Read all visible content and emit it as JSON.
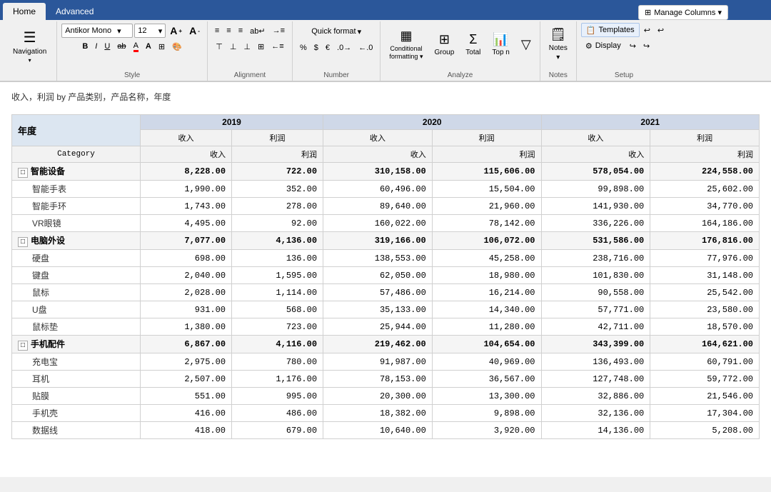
{
  "tabs": [
    {
      "label": "Home",
      "active": true
    },
    {
      "label": "Advanced",
      "active": false
    }
  ],
  "manage_columns": "Manage Columns ▾",
  "ribbon": {
    "groups": {
      "navigation": {
        "label": "Navigation",
        "icon": "☰",
        "arrow": "▾"
      },
      "style": {
        "label": "Style",
        "font": "Antikor Mono",
        "size": "12",
        "size_arrow": "▾"
      },
      "alignment": {
        "label": "Alignment"
      },
      "number": {
        "label": "Number",
        "quick_format": "Quick format",
        "quick_format_arrow": "▾"
      },
      "analyze": {
        "label": "Analyze",
        "conditional": "Conditional",
        "formatting": "formatting",
        "formatting_arrow": "▾",
        "group": "Group",
        "total": "Total",
        "top_n": "Top n"
      },
      "notes": {
        "label": "Notes",
        "notes": "Notes",
        "notes_arrow": "▾"
      },
      "setup": {
        "label": "Setup",
        "templates": "Templates",
        "display": "Display"
      }
    }
  },
  "breadcrumb": "收入，利润 by 产品类别，产品名称，年度",
  "table": {
    "year_col": "年度",
    "years": [
      "2019",
      "2020",
      "2021"
    ],
    "subcols": [
      "收入",
      "利润"
    ],
    "category_label": "Category",
    "rows": [
      {
        "type": "group",
        "label": "智能设备",
        "expand": "□",
        "values": [
          "8,228.00",
          "722.00",
          "310,158.00",
          "115,606.00",
          "578,054.00",
          "224,558.00"
        ],
        "children": [
          {
            "label": "智能手表",
            "values": [
              "1,990.00",
              "352.00",
              "60,496.00",
              "15,504.00",
              "99,898.00",
              "25,602.00"
            ]
          },
          {
            "label": "智能手环",
            "values": [
              "1,743.00",
              "278.00",
              "89,640.00",
              "21,960.00",
              "141,930.00",
              "34,770.00"
            ]
          },
          {
            "label": "VR眼镜",
            "values": [
              "4,495.00",
              "92.00",
              "160,022.00",
              "78,142.00",
              "336,226.00",
              "164,186.00"
            ]
          }
        ]
      },
      {
        "type": "group",
        "label": "电脑外设",
        "expand": "□",
        "values": [
          "7,077.00",
          "4,136.00",
          "319,166.00",
          "106,072.00",
          "531,586.00",
          "176,816.00"
        ],
        "children": [
          {
            "label": "硬盘",
            "values": [
              "698.00",
              "136.00",
              "138,553.00",
              "45,258.00",
              "238,716.00",
              "77,976.00"
            ]
          },
          {
            "label": "键盘",
            "values": [
              "2,040.00",
              "1,595.00",
              "62,050.00",
              "18,980.00",
              "101,830.00",
              "31,148.00"
            ]
          },
          {
            "label": "鼠标",
            "values": [
              "2,028.00",
              "1,114.00",
              "57,486.00",
              "16,214.00",
              "90,558.00",
              "25,542.00"
            ]
          },
          {
            "label": "U盘",
            "values": [
              "931.00",
              "568.00",
              "35,133.00",
              "14,340.00",
              "57,771.00",
              "23,580.00"
            ]
          },
          {
            "label": "鼠标垫",
            "values": [
              "1,380.00",
              "723.00",
              "25,944.00",
              "11,280.00",
              "42,711.00",
              "18,570.00"
            ]
          }
        ]
      },
      {
        "type": "group",
        "label": "手机配件",
        "expand": "□",
        "values": [
          "6,867.00",
          "4,116.00",
          "219,462.00",
          "104,654.00",
          "343,399.00",
          "164,621.00"
        ],
        "children": [
          {
            "label": "充电宝",
            "values": [
              "2,975.00",
              "780.00",
              "91,987.00",
              "40,969.00",
              "136,493.00",
              "60,791.00"
            ]
          },
          {
            "label": "耳机",
            "values": [
              "2,507.00",
              "1,176.00",
              "78,153.00",
              "36,567.00",
              "127,748.00",
              "59,772.00"
            ]
          },
          {
            "label": "贴膜",
            "values": [
              "551.00",
              "995.00",
              "20,300.00",
              "13,300.00",
              "32,886.00",
              "21,546.00"
            ]
          },
          {
            "label": "手机壳",
            "values": [
              "416.00",
              "486.00",
              "18,382.00",
              "9,898.00",
              "32,136.00",
              "17,304.00"
            ]
          },
          {
            "label": "数据线",
            "values": [
              "418.00",
              "679.00",
              "10,640.00",
              "3,920.00",
              "14,136.00",
              "5,208.00"
            ]
          }
        ]
      }
    ]
  }
}
